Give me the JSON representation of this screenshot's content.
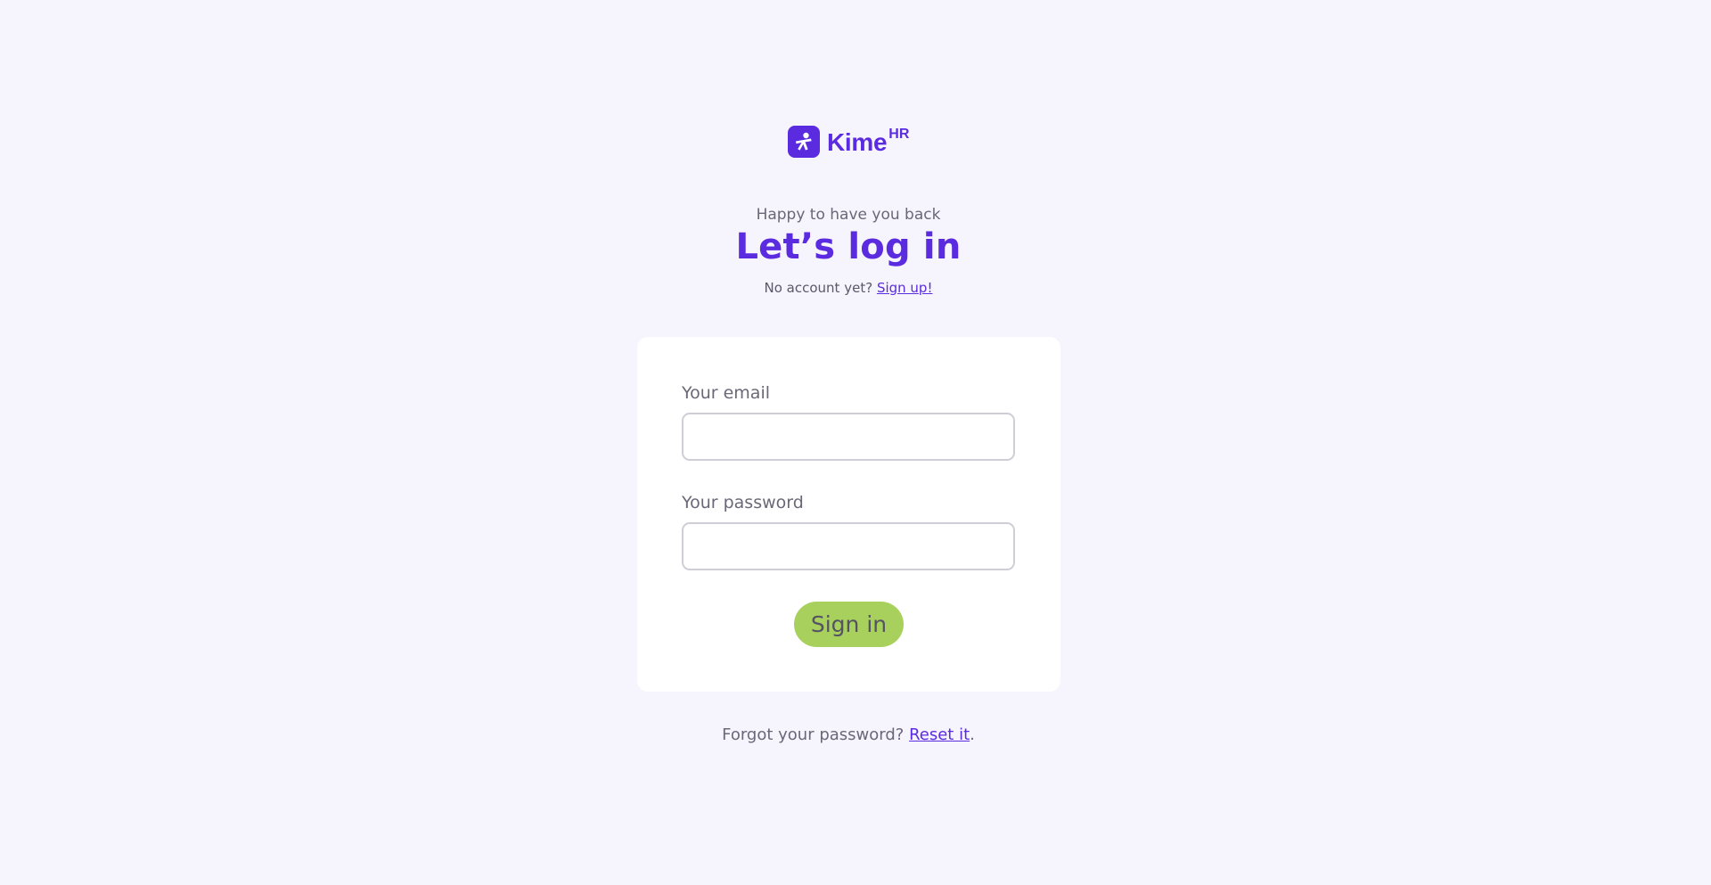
{
  "brand": {
    "name": "Kime",
    "superscript": "HR",
    "icon": "kime-logo-icon",
    "color": "#5b2be0"
  },
  "header": {
    "subtitle": "Happy to have you back",
    "title": "Let’s log in",
    "no_account_text": "No account yet?",
    "signup_link": "Sign up!"
  },
  "form": {
    "email_label": "Your email",
    "email_value": "",
    "password_label": "Your password",
    "password_value": "",
    "submit_label": "Sign in",
    "submit_color": "#a8d05c"
  },
  "footer": {
    "forgot_text": "Forgot your password?",
    "reset_link": "Reset it",
    "trailing": "."
  }
}
